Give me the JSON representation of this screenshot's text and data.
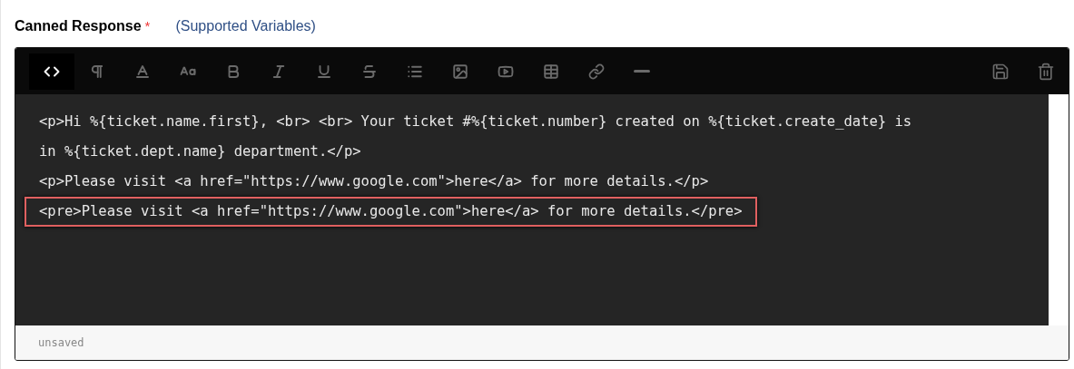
{
  "field": {
    "label": "Canned Response",
    "required_mark": "*",
    "help_link": "(Supported Variables)"
  },
  "toolbar": {
    "tools": [
      {
        "kind": "code",
        "selected": true
      },
      {
        "kind": "paragraph",
        "selected": false
      },
      {
        "kind": "color",
        "selected": false
      },
      {
        "kind": "fontsize",
        "selected": false
      },
      {
        "kind": "bold",
        "selected": false
      },
      {
        "kind": "italic",
        "selected": false
      },
      {
        "kind": "underline",
        "selected": false
      },
      {
        "kind": "strike",
        "selected": false
      },
      {
        "kind": "list",
        "selected": false
      },
      {
        "kind": "image",
        "selected": false
      },
      {
        "kind": "video",
        "selected": false
      },
      {
        "kind": "table",
        "selected": false
      },
      {
        "kind": "link",
        "selected": false
      },
      {
        "kind": "rule",
        "selected": false
      }
    ],
    "actions": [
      {
        "kind": "save"
      },
      {
        "kind": "delete"
      }
    ]
  },
  "editor": {
    "lines": [
      {
        "text": "<p>Hi %{ticket.name.first}, <br> <br> Your ticket #%{ticket.number} created on %{ticket.create_date} is",
        "highlighted": false
      },
      {
        "text": "in %{ticket.dept.name} department.</p>",
        "highlighted": false
      },
      {
        "text": "<p>Please visit <a href=\"https://www.google.com\">here</a> for more details.</p>",
        "highlighted": false
      },
      {
        "text": "<pre>Please visit <a href=\"https://www.google.com\">here</a> for more details.</pre>",
        "highlighted": true
      }
    ]
  },
  "status": "unsaved"
}
